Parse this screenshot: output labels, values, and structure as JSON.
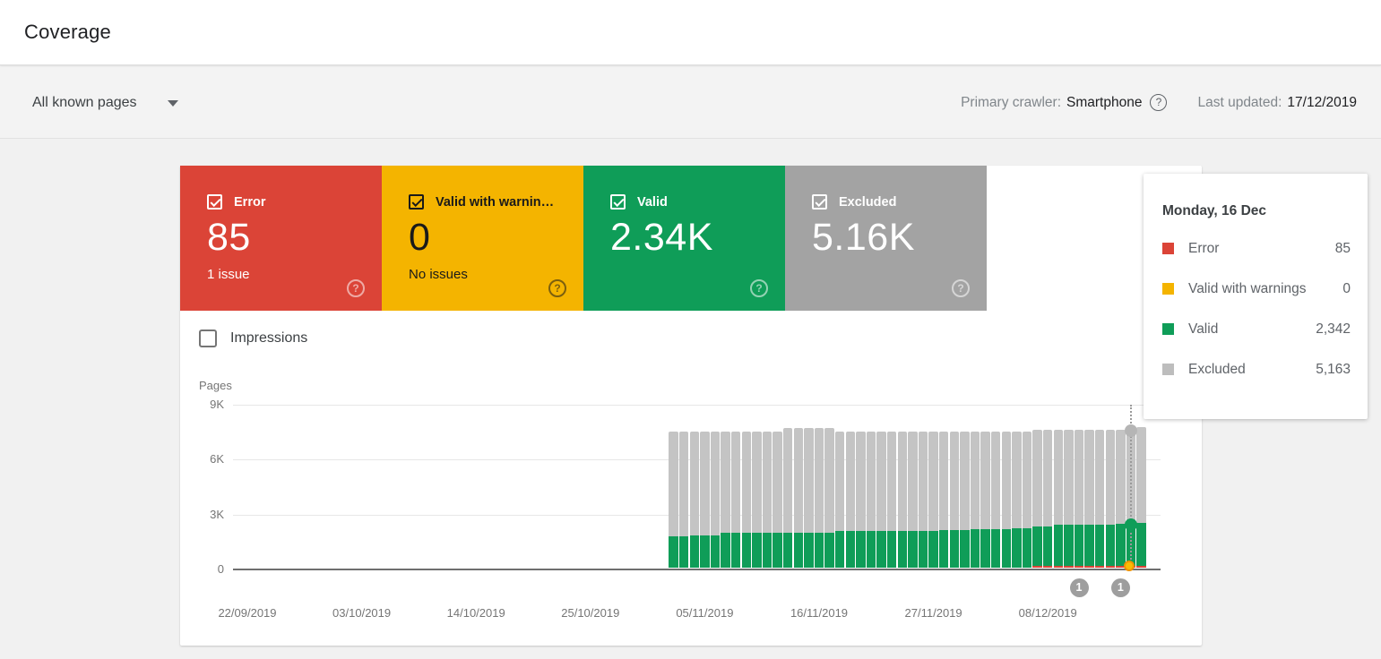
{
  "header": {
    "title": "Coverage"
  },
  "filter_bar": {
    "page_filter": "All known pages",
    "primary_crawler_label": "Primary crawler:",
    "primary_crawler_value": "Smartphone",
    "help_glyph": "?",
    "last_updated_label": "Last updated:",
    "last_updated_value": "17/12/2019"
  },
  "status_cards": [
    {
      "id": "error",
      "label": "Error",
      "value": "85",
      "subtext": "1 issue",
      "color": "#DB4437",
      "text_color": "#ffffff",
      "checked": true
    },
    {
      "id": "valid-with-warnings",
      "label": "Valid with warnin…",
      "value": "0",
      "subtext": "No issues",
      "color": "#F4B400",
      "text_color": "#1a1a1a",
      "checked": true
    },
    {
      "id": "valid",
      "label": "Valid",
      "value": "2.34K",
      "subtext": "",
      "color": "#0F9D58",
      "text_color": "#ffffff",
      "checked": true
    },
    {
      "id": "excluded",
      "label": "Excluded",
      "value": "5.16K",
      "subtext": "",
      "color": "#A3A3A3",
      "text_color": "#ffffff",
      "checked": true
    }
  ],
  "impressions_toggle": {
    "label": "Impressions",
    "checked": false
  },
  "tooltip": {
    "title": "Monday, 16 Dec",
    "rows": [
      {
        "label": "Error",
        "value": "85",
        "color": "#DB4437"
      },
      {
        "label": "Valid with warnings",
        "value": "0",
        "color": "#F4B400"
      },
      {
        "label": "Valid",
        "value": "2,342",
        "color": "#0F9D58"
      },
      {
        "label": "Excluded",
        "value": "5,163",
        "color": "#BDBDBD"
      }
    ]
  },
  "chart_data": {
    "type": "bar",
    "stacked": true,
    "ylabel": "Pages",
    "ylim": [
      0,
      9000
    ],
    "yticks": [
      {
        "label": "0",
        "value": 0
      },
      {
        "label": "3K",
        "value": 3000
      },
      {
        "label": "6K",
        "value": 6000
      },
      {
        "label": "9K",
        "value": 9000
      }
    ],
    "x_start": "22/09/2019",
    "x_axis_labels": [
      "22/09/2019",
      "03/10/2019",
      "14/10/2019",
      "25/10/2019",
      "05/11/2019",
      "16/11/2019",
      "27/11/2019",
      "08/12/2019"
    ],
    "dates": [
      "02/11/2019",
      "03/11/2019",
      "04/11/2019",
      "05/11/2019",
      "06/11/2019",
      "07/11/2019",
      "08/11/2019",
      "09/11/2019",
      "10/11/2019",
      "11/11/2019",
      "12/11/2019",
      "13/11/2019",
      "14/11/2019",
      "15/11/2019",
      "16/11/2019",
      "17/11/2019",
      "18/11/2019",
      "19/11/2019",
      "20/11/2019",
      "21/11/2019",
      "22/11/2019",
      "23/11/2019",
      "24/11/2019",
      "25/11/2019",
      "26/11/2019",
      "27/11/2019",
      "28/11/2019",
      "29/11/2019",
      "30/11/2019",
      "01/12/2019",
      "02/12/2019",
      "03/12/2019",
      "04/12/2019",
      "05/12/2019",
      "06/12/2019",
      "07/12/2019",
      "08/12/2019",
      "09/12/2019",
      "10/12/2019",
      "11/12/2019",
      "12/12/2019",
      "13/12/2019",
      "14/12/2019",
      "15/12/2019",
      "16/12/2019",
      "17/12/2019"
    ],
    "series": [
      {
        "name": "Error",
        "color": "#DB4437",
        "values": [
          0,
          0,
          0,
          0,
          0,
          0,
          0,
          0,
          0,
          0,
          0,
          0,
          0,
          0,
          0,
          0,
          0,
          0,
          0,
          0,
          0,
          0,
          0,
          0,
          0,
          0,
          0,
          0,
          0,
          0,
          0,
          0,
          0,
          0,
          0,
          45,
          50,
          55,
          60,
          65,
          70,
          75,
          80,
          85,
          85,
          85
        ]
      },
      {
        "name": "Valid with warnings",
        "color": "#F4B400",
        "values": [
          0,
          0,
          0,
          0,
          0,
          0,
          0,
          0,
          0,
          0,
          0,
          0,
          0,
          0,
          0,
          0,
          0,
          0,
          0,
          0,
          0,
          0,
          0,
          0,
          0,
          0,
          0,
          0,
          0,
          0,
          0,
          0,
          0,
          0,
          0,
          0,
          0,
          0,
          0,
          0,
          0,
          0,
          0,
          0,
          0,
          0
        ]
      },
      {
        "name": "Valid",
        "color": "#0F9D58",
        "values": [
          1730,
          1735,
          1740,
          1745,
          1750,
          1895,
          1900,
          1900,
          1905,
          1905,
          1910,
          1910,
          1915,
          1920,
          1925,
          1930,
          1985,
          1990,
          1995,
          2000,
          2000,
          2005,
          2010,
          2015,
          2020,
          2025,
          2065,
          2070,
          2075,
          2080,
          2085,
          2090,
          2125,
          2130,
          2135,
          2140,
          2145,
          2245,
          2250,
          2255,
          2260,
          2265,
          2275,
          2285,
          2342,
          2360
        ]
      },
      {
        "name": "Excluded",
        "color": "#C4C4C4",
        "values": [
          5700,
          5700,
          5700,
          5700,
          5700,
          5540,
          5540,
          5545,
          5545,
          5550,
          5550,
          5720,
          5720,
          5715,
          5710,
          5705,
          5440,
          5440,
          5435,
          5435,
          5430,
          5430,
          5425,
          5425,
          5420,
          5420,
          5360,
          5360,
          5355,
          5355,
          5350,
          5350,
          5310,
          5310,
          5305,
          5305,
          5300,
          5190,
          5190,
          5185,
          5185,
          5180,
          5175,
          5170,
          5163,
          5200
        ]
      }
    ],
    "hovered_date": "16/12/2019",
    "event_markers": [
      {
        "label": "1",
        "date": "11/12/2019"
      },
      {
        "label": "1",
        "date": "15/12/2019"
      }
    ],
    "legend_position": "none",
    "grid": true
  }
}
